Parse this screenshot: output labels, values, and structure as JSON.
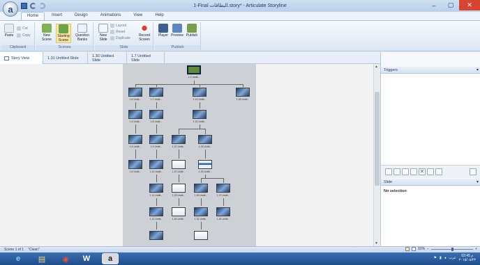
{
  "window": {
    "title": "1-Final البطاقات.story* - Articulate Storyline",
    "app_logo_letter": "a",
    "controls": {
      "minimize": "–",
      "maximize": "▢",
      "close": "✕"
    }
  },
  "ribbon_tabs": [
    {
      "label": "Home",
      "active": true
    },
    {
      "label": "Insert",
      "active": false
    },
    {
      "label": "Design",
      "active": false
    },
    {
      "label": "Animations",
      "active": false
    },
    {
      "label": "View",
      "active": false
    },
    {
      "label": "Help",
      "active": false
    }
  ],
  "ribbon": {
    "clipboard": {
      "label": "Clipboard",
      "paste": "Paste",
      "cut": "Cut",
      "copy": "Copy"
    },
    "scenes": {
      "label": "Scenes",
      "new_scene": "New Scene",
      "starting_scene": "Starting Scene",
      "question_banks": "Question Banks"
    },
    "slide": {
      "label": "Slide",
      "new_slide": "New Slide",
      "layout": "Layout",
      "reset": "Reset",
      "duplicate": "Duplicate",
      "record_screen": "Record Screen"
    },
    "publish": {
      "label": "Publish",
      "player": "Player",
      "preview": "Preview",
      "publish": "Publish"
    }
  },
  "view_tabs": [
    {
      "label": "Story View",
      "active": true
    },
    {
      "label": "1.31 Untitled Slide",
      "active": false
    },
    {
      "label": "1.30 Untitled Slide",
      "active": false
    },
    {
      "label": "1.7 Untitled Slide",
      "active": false
    }
  ],
  "story_map": {
    "nodes": [
      {
        "label": "1.2 Untitl...",
        "style": "green"
      },
      {
        "label": "1.6 Untitl...",
        "style": "dark"
      },
      {
        "label": "1.7 Untitl...",
        "style": "dark"
      },
      {
        "label": "1.19 Untitl...",
        "style": "dark"
      },
      {
        "label": "1.28 Untitl...",
        "style": "dark"
      },
      {
        "label": "1.4 Untitl...",
        "style": "dark"
      },
      {
        "label": "1.8 Untitl...",
        "style": "dark"
      },
      {
        "label": "1.20 Untitl...",
        "style": "dark"
      },
      {
        "label": "1.5 Untitl...",
        "style": "dark"
      },
      {
        "label": "1.9 Untitl...",
        "style": "dark"
      },
      {
        "label": "1.21 Untitl...",
        "style": "dark"
      },
      {
        "label": "1.25 Untitl...",
        "style": "dark"
      },
      {
        "label": "1.6 Untitl...",
        "style": "dark"
      },
      {
        "label": "1.10 Untitl...",
        "style": "dark"
      },
      {
        "label": "1.22 Untitl...",
        "style": "white"
      },
      {
        "label": "1.29 Untitl...",
        "style": "blue"
      },
      {
        "label": "1.11 Untitl...",
        "style": "dark"
      },
      {
        "label": "1.23 Untitl...",
        "style": "white"
      },
      {
        "label": "1.30 Untitl...",
        "style": "dark"
      },
      {
        "label": "1.27 Untitl...",
        "style": "dark"
      },
      {
        "label": "1.12 Untitl...",
        "style": "dark"
      },
      {
        "label": "1.24 Untitl...",
        "style": "white"
      },
      {
        "label": "1.31 Untitl...",
        "style": "dark"
      },
      {
        "label": "1.26 Untitl...",
        "style": "dark"
      },
      {
        "label": "",
        "style": "dark"
      },
      {
        "label": "",
        "style": "white"
      }
    ]
  },
  "triggers_panel": {
    "title": "Triggers"
  },
  "slide_panel": {
    "title": "Slide",
    "empty_text": "No selection"
  },
  "statusbar": {
    "scene": "Scene 1 of 1",
    "theme": "\"Clean\"",
    "zoom": "50%",
    "zoom_level": 0.5
  },
  "taskbar": {
    "apps": [
      "ie",
      "explorer",
      "chrome",
      "word",
      "storyline"
    ],
    "tray_lang": "عرب",
    "time": "02:45 م",
    "date": "۲۰۱۵/۰۸/۲۳"
  }
}
